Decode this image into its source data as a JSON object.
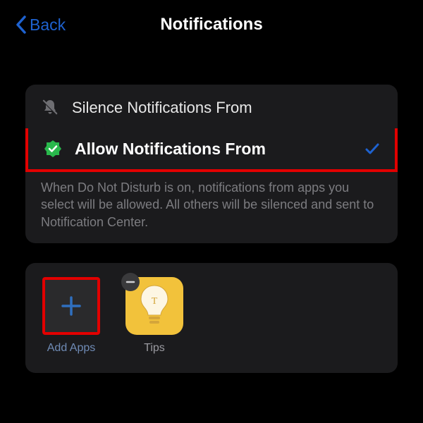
{
  "header": {
    "back_label": "Back",
    "title": "Notifications"
  },
  "options": {
    "silence": {
      "label": "Silence Notifications From"
    },
    "allow": {
      "label": "Allow Notifications From",
      "selected": true
    }
  },
  "description": "When Do Not Disturb is on, notifications from apps you select will be allowed. All others will be silenced and sent to Notification Center.",
  "apps": {
    "add": {
      "label": "Add Apps"
    },
    "tips": {
      "label": "Tips"
    }
  },
  "colors": {
    "accent": "#1e62d0",
    "highlight": "#e20000",
    "tips_bg": "#f2c23b"
  }
}
